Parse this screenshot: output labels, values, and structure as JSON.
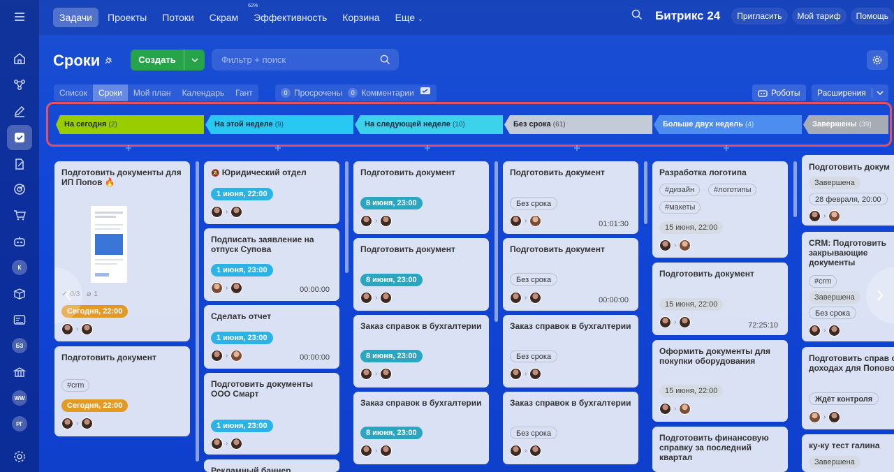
{
  "topbar": {
    "tabs": [
      {
        "label": "Задачи",
        "active": true
      },
      {
        "label": "Проекты"
      },
      {
        "label": "Потоки"
      },
      {
        "label": "Скрам"
      },
      {
        "label": "Эффективность",
        "sup": "62%"
      },
      {
        "label": "Корзина"
      },
      {
        "label": "Еще"
      }
    ],
    "brand": "Битрикс 24",
    "invite": "Пригласить",
    "tariff": "Мой тариф",
    "help": "Помощь"
  },
  "leftbar": {
    "avatars": [
      "К",
      "БЗ",
      "WW",
      "РГ"
    ]
  },
  "header": {
    "title": "Сроки",
    "create_label": "Создать",
    "search_placeholder": "Фильтр + поиск"
  },
  "viewtabs": [
    "Список",
    "Сроки",
    "Мой план",
    "Календарь",
    "Гант"
  ],
  "counters": {
    "overdue_num": "0",
    "overdue_label": "Просрочены",
    "comments_num": "0",
    "comments_label": "Комментарии"
  },
  "robots_label": "Роботы",
  "extensions_label": "Расширения",
  "colors": {
    "today": "#9acd00",
    "week": "#29c8f2",
    "next_week": "#3cd2ec",
    "no_deadline": "#c3cad8",
    "two_weeks": "#4d8df0",
    "done": "#a7abb3",
    "frame": "#e8505f"
  },
  "stages": [
    {
      "name": "На сегодня",
      "count": "(2)"
    },
    {
      "name": "На этой неделе",
      "count": "(9)"
    },
    {
      "name": "На следующей неделе",
      "count": "(10)"
    },
    {
      "name": "Без срока",
      "count": "(61)"
    },
    {
      "name": "Больше двух недель",
      "count": "(4)"
    },
    {
      "name": "Завершены",
      "count": "(39)"
    }
  ],
  "col1": {
    "c1": {
      "title": "Подготовить документы для ИП Попов 🔥",
      "checklist": "0/3",
      "files": "1",
      "deadline": "Сегодня, 22:00"
    },
    "c2": {
      "title": "Подготовить документ",
      "tag": "#crm",
      "deadline": "Сегодня, 22:00"
    }
  },
  "col2": {
    "c1": {
      "title": "Юридический отдел",
      "deadline": "1 июня, 22:00"
    },
    "c2": {
      "title": "Подписать заявление на отпуск Супова",
      "deadline": "1 июня, 23:00",
      "timer": "00:00:00"
    },
    "c3": {
      "title": "Сделать отчет",
      "deadline": "1 июня, 23:00",
      "timer": "00:00:00"
    },
    "c4": {
      "title": "Подготовить документы ООО Смарт",
      "deadline": "1 июня, 23:00"
    },
    "c5": {
      "title": "Рекламный баннер"
    }
  },
  "col3": {
    "c1": {
      "title": "Подготовить документ",
      "deadline": "8 июня, 23:00"
    },
    "c2": {
      "title": "Подготовить документ",
      "deadline": "8 июня, 23:00"
    },
    "c3": {
      "title": "Заказ справок в бухгалтерии",
      "deadline": "8 июня, 23:00"
    },
    "c4": {
      "title": "Заказ справок в бухгалтерии",
      "deadline": "8 июня, 23:00"
    }
  },
  "col4": {
    "c1": {
      "title": "Подготовить документ",
      "deadline": "Без срока",
      "timer": "01:01:30"
    },
    "c2": {
      "title": "Подготовить документ",
      "deadline": "Без срока",
      "timer": "00:00:00"
    },
    "c3": {
      "title": "Заказ справок в бухгалтерии",
      "deadline": "Без срока"
    },
    "c4": {
      "title": "Заказ справок в бухгалтерии",
      "deadline": "Без срока"
    }
  },
  "col5": {
    "c1": {
      "title": "Разработка логотипа",
      "tags": [
        "#дизайн",
        "#логотипы",
        "#макеты"
      ],
      "deadline": "15 июня, 22:00"
    },
    "c2": {
      "title": "Подготовить документ",
      "deadline": "15 июня, 22:00",
      "timer": "72:25:10"
    },
    "c3": {
      "title": "Оформить документы для покупки оборудования",
      "deadline": "15 июня, 22:00"
    },
    "c4": {
      "title": "Подготовить финансовую справку за последний квартал"
    }
  },
  "col6": {
    "c1": {
      "title": "Подготовить докум",
      "status": "Завершена",
      "deadline": "28 февраля, 20:00"
    },
    "c2": {
      "title": "CRM: Подготовить закрывающие документы",
      "tag": "#crm",
      "status": "Завершена",
      "deadline": "Без срока"
    },
    "c3": {
      "title": "Подготовить справ о доходах для Поповой",
      "status": "Ждёт контроля"
    },
    "c4": {
      "title": "ку-ку тест галина",
      "status": "Завершена"
    }
  }
}
